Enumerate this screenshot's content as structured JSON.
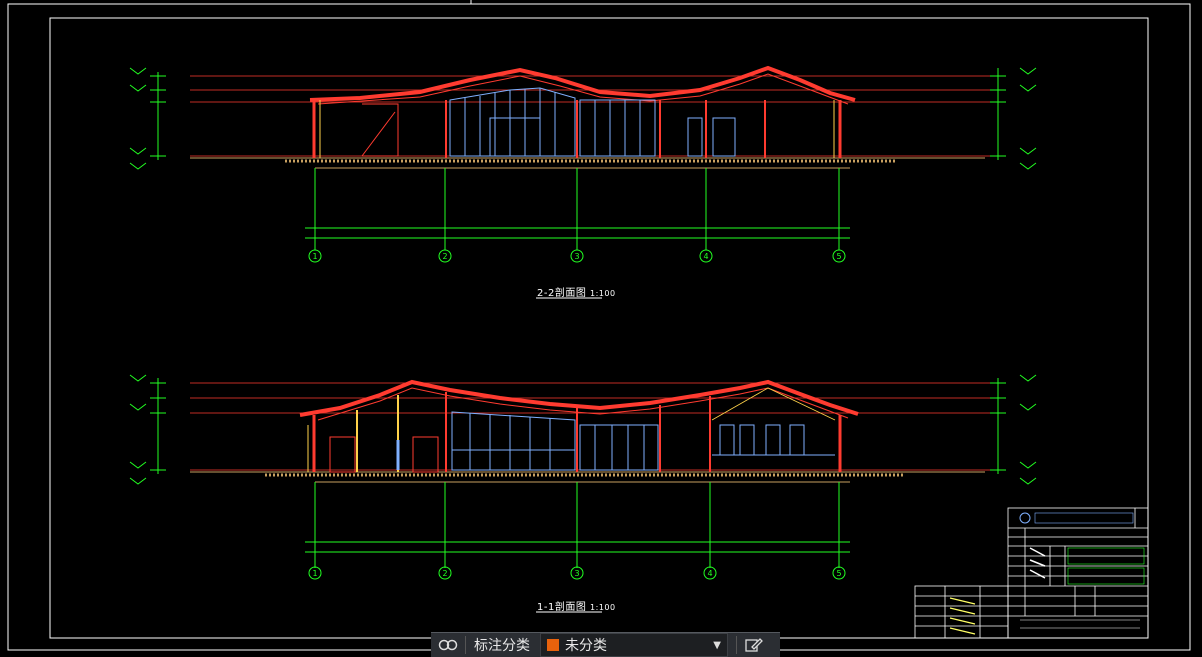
{
  "drawing": {
    "section_22_title": "2-2剖面图",
    "section_22_scale": "1:100",
    "section_11_title": "1-1剖面图",
    "section_11_scale": "1:100",
    "axis_labels": [
      "1",
      "2",
      "3",
      "4",
      "5"
    ],
    "colors": {
      "background": "#000000",
      "roof": "#ff3b30",
      "glazing": "#7fb0ff",
      "dimension": "#22ff22",
      "frame": "#ffffff",
      "structure": "#ffd24a",
      "grade": "#c8a060",
      "axis_bubble": "#22ff22"
    }
  },
  "toolbar": {
    "filter_icon": "link-icon",
    "filter_label": "标注分类",
    "category_value": "未分类",
    "category_swatch": "#e8620c",
    "dropdown_icon": "chevron-down-icon",
    "edit_icon": "edit-icon"
  }
}
